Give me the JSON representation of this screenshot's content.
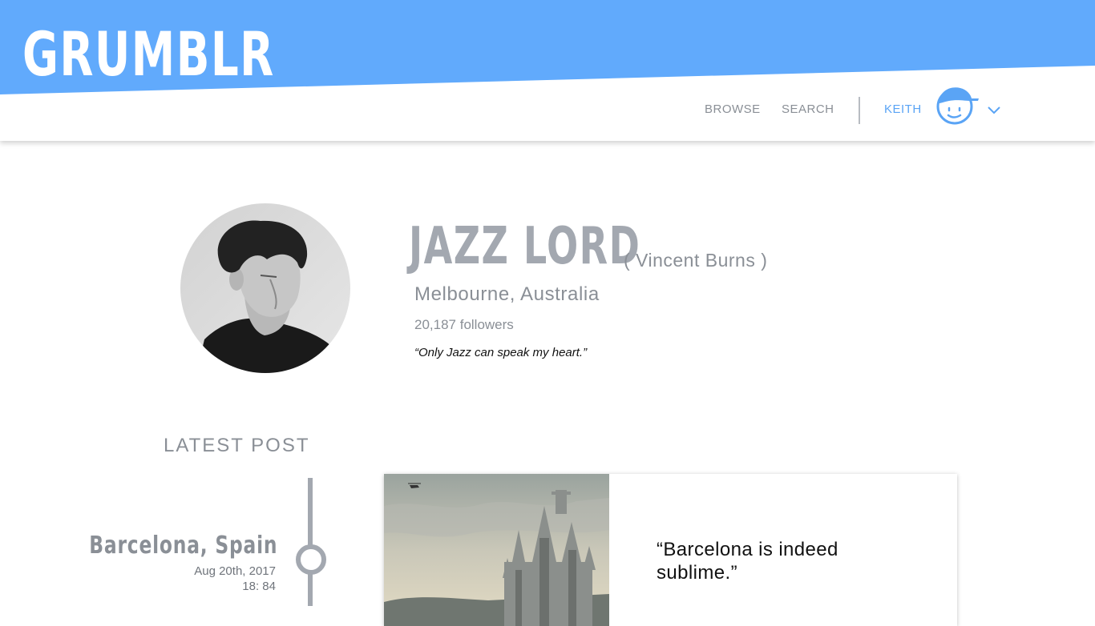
{
  "colors": {
    "brand_blue": "#61aafc",
    "accent_blue": "#5aa4f5",
    "muted_gray": "#8a8f96",
    "heading_gray": "#a3a8b0"
  },
  "header": {
    "logo": "GRUMBLR",
    "nav": {
      "browse": "BROWSE",
      "search": "SEARCH"
    },
    "user": {
      "name": "KEITH",
      "avatar_icon": "cartoon-face-cap-icon",
      "menu_icon": "chevron-down-icon"
    }
  },
  "profile": {
    "display_name": "JAZZ LORD",
    "real_name": "( Vincent Burns )",
    "location": "Melbourne, Australia",
    "followers": "20,187 followers",
    "quote": "“Only Jazz can speak my heart.”"
  },
  "latest_post": {
    "section_title": "LATEST POST",
    "location": "Barcelona, Spain",
    "date": "Aug 20th, 2017",
    "time": "18: 84",
    "quote": "“Barcelona is indeed sublime.”"
  }
}
